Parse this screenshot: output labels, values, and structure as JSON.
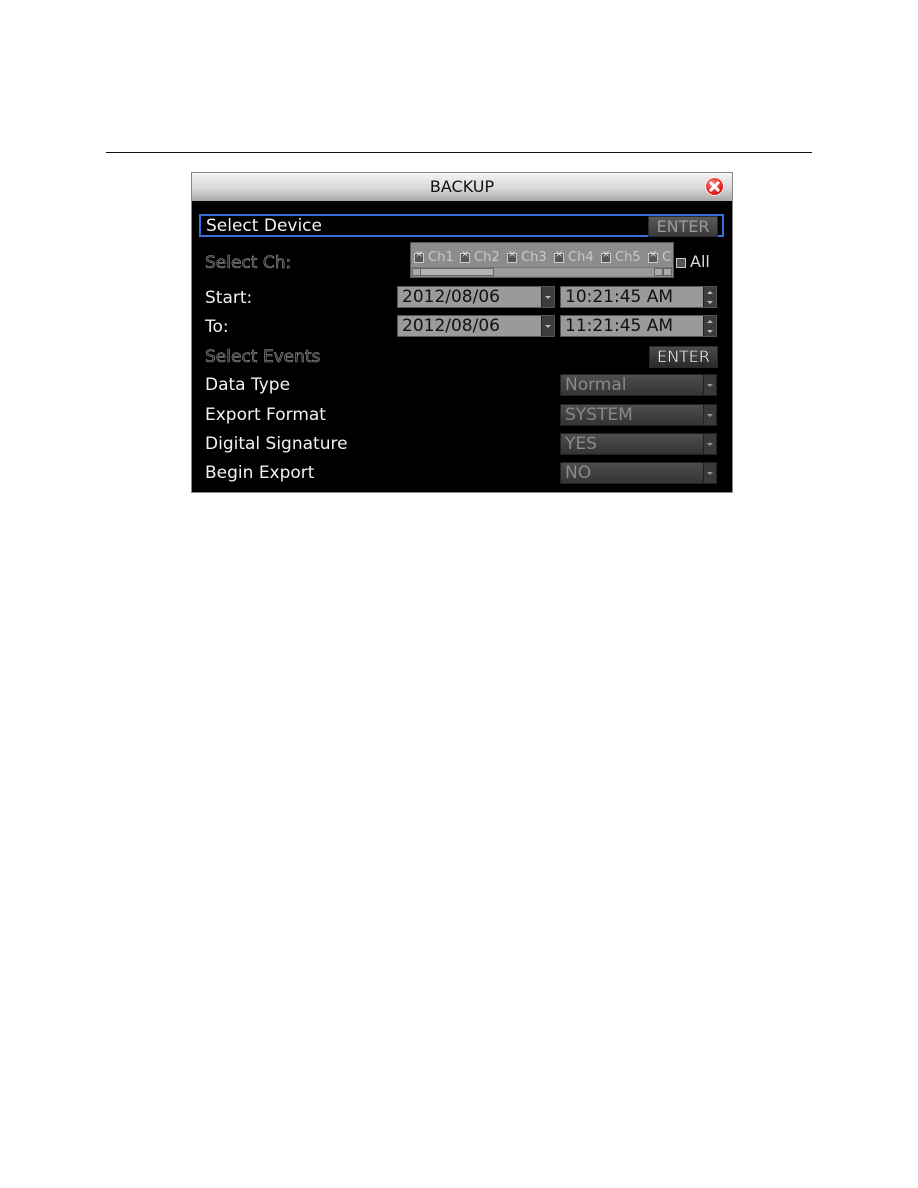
{
  "dialog": {
    "title": "BACKUP",
    "close_icon": "close-icon"
  },
  "select_device": {
    "label": "Select Device",
    "button": "ENTER"
  },
  "select_channel": {
    "label": "Select Ch:",
    "channels": [
      "Ch1",
      "Ch2",
      "Ch3",
      "Ch4",
      "Ch5",
      "C"
    ],
    "all_label": "All"
  },
  "start": {
    "label": "Start:",
    "date": "2012/08/06",
    "time": "10:21:45 AM"
  },
  "to": {
    "label": "To:",
    "date": "2012/08/06",
    "time": "11:21:45 AM"
  },
  "select_events": {
    "label": "Select Events",
    "button": "ENTER"
  },
  "data_type": {
    "label": "Data Type",
    "value": "Normal"
  },
  "export_format": {
    "label": "Export Format",
    "value": "SYSTEM"
  },
  "digital_signature": {
    "label": "Digital Signature",
    "value": "YES"
  },
  "begin_export": {
    "label": "Begin Export",
    "value": "NO"
  }
}
